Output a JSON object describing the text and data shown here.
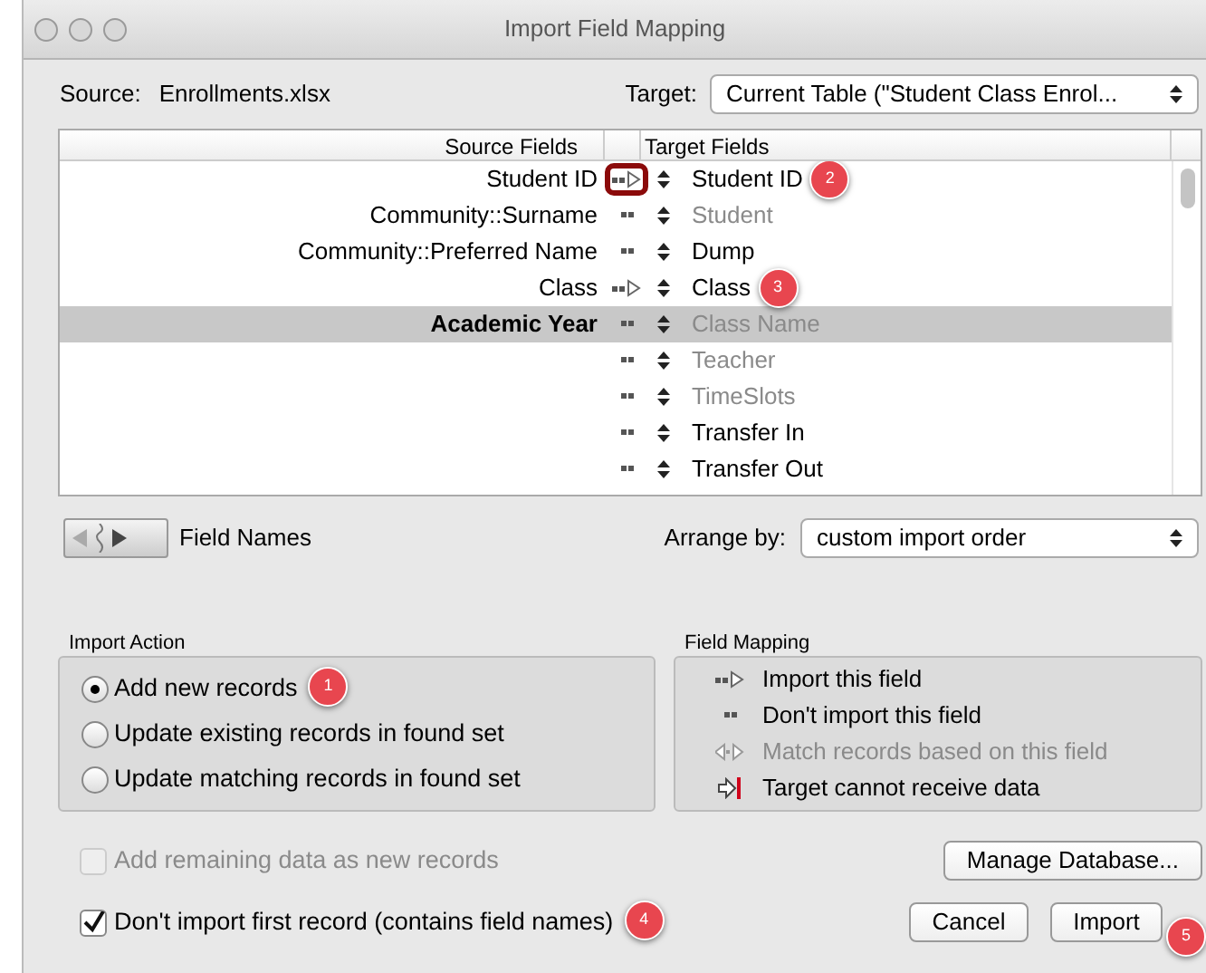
{
  "window": {
    "title": "Import Field Mapping"
  },
  "source": {
    "label": "Source:",
    "value": "Enrollments.xlsx"
  },
  "target": {
    "label": "Target:",
    "value": "Current Table (\"Student Class Enrol..."
  },
  "table": {
    "columns": [
      "Source Fields",
      "Target Fields"
    ],
    "rows": [
      {
        "source": "Student ID",
        "kind": "import",
        "target": "Student ID",
        "target_enabled": true,
        "selected": false,
        "highlighted": true,
        "badge": "2"
      },
      {
        "source": "Community::Surname",
        "kind": "skip",
        "target": "Student",
        "target_enabled": false,
        "selected": false,
        "highlighted": false
      },
      {
        "source": "Community::Preferred Name",
        "kind": "skip",
        "target": "Dump",
        "target_enabled": true,
        "selected": false,
        "highlighted": false
      },
      {
        "source": "Class",
        "kind": "import",
        "target": "Class",
        "target_enabled": true,
        "selected": false,
        "highlighted": false,
        "badge": "3"
      },
      {
        "source": "Academic Year",
        "kind": "skip",
        "target": "Class Name",
        "target_enabled": false,
        "selected": true,
        "highlighted": false
      },
      {
        "source": "",
        "kind": "skip",
        "target": "Teacher",
        "target_enabled": false,
        "selected": false,
        "highlighted": false
      },
      {
        "source": "",
        "kind": "skip",
        "target": "TimeSlots",
        "target_enabled": false,
        "selected": false,
        "highlighted": false
      },
      {
        "source": "",
        "kind": "skip",
        "target": "Transfer In",
        "target_enabled": true,
        "selected": false,
        "highlighted": false
      },
      {
        "source": "",
        "kind": "skip",
        "target": "Transfer Out",
        "target_enabled": true,
        "selected": false,
        "highlighted": false
      }
    ]
  },
  "record_nav": {
    "label": "Field Names"
  },
  "arrange": {
    "label": "Arrange by:",
    "value": "custom import order"
  },
  "import_action": {
    "title": "Import Action",
    "options": [
      {
        "label": "Add new records",
        "selected": true,
        "badge": "1"
      },
      {
        "label": "Update existing records in found set",
        "selected": false
      },
      {
        "label": "Update matching records in found set",
        "selected": false
      }
    ]
  },
  "field_mapping": {
    "title": "Field Mapping",
    "legend": [
      {
        "kind": "import",
        "label": "Import this field",
        "disabled": false
      },
      {
        "kind": "skip",
        "label": "Don't import this field",
        "disabled": false
      },
      {
        "kind": "match",
        "label": "Match records based on this field",
        "disabled": true
      },
      {
        "kind": "blocked",
        "label": "Target cannot receive data",
        "disabled": false
      }
    ]
  },
  "options": [
    {
      "label": "Add remaining data as new records",
      "checked": false,
      "disabled": true
    },
    {
      "label": "Don't import first record (contains field names)",
      "checked": true,
      "disabled": false,
      "badge": "4"
    }
  ],
  "buttons": {
    "manage": "Manage Database...",
    "cancel": "Cancel",
    "import": "Import",
    "import_badge": "5"
  }
}
